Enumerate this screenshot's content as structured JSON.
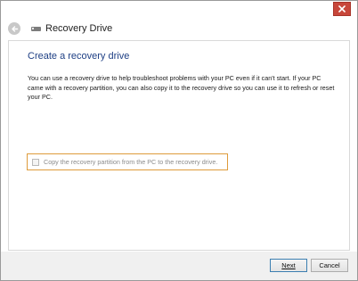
{
  "window": {
    "nav_title": "Recovery Drive"
  },
  "icons": {
    "close": "close-icon",
    "back": "back-arrow-icon",
    "drive": "drive-icon"
  },
  "colors": {
    "heading": "#1e3f84",
    "close_button": "#c7463a",
    "highlight_border": "#de9b3b"
  },
  "main": {
    "heading": "Create a recovery drive",
    "description": "You can use a recovery drive to help troubleshoot problems with your PC even if it can't start. If your PC came with a recovery partition, you can also copy it to the recovery drive so you can use it to refresh or reset your PC.",
    "copy_option": {
      "label": "Copy the recovery partition from the PC to the recovery drive.",
      "checked": false,
      "enabled": false
    }
  },
  "footer": {
    "next_label": "Next",
    "cancel_label": "Cancel"
  }
}
